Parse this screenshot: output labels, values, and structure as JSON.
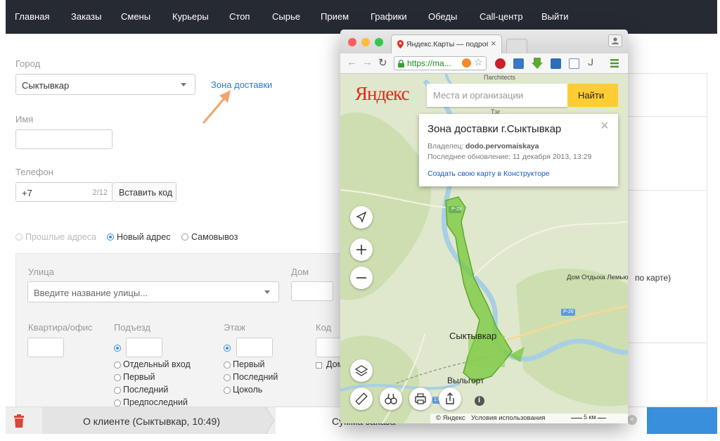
{
  "nav": {
    "items": [
      "Главная",
      "Заказы",
      "Смены",
      "Курьеры",
      "Стоп",
      "Сырье",
      "Прием",
      "Графики",
      "Обеды",
      "Call-центр",
      "Выйти"
    ]
  },
  "form": {
    "city_label": "Город",
    "city_value": "Сыктывкар",
    "zone_link": "Зона доставки",
    "name_label": "Имя",
    "phone_label": "Телефон",
    "phone_value": "+7",
    "phone_counter": "2/12",
    "insert_code_button": "Вставить код",
    "address_modes": {
      "past": "Прошлые адреса",
      "new": "Новый адрес",
      "pickup": "Самовывоз"
    },
    "street_label": "Улица",
    "street_placeholder": "Введите название улицы...",
    "house_label": "Дом",
    "apartment_label": "Квартира/офис",
    "entrance_label": "Подъезд",
    "floor_label": "Этаж",
    "code_label": "Код",
    "entrance_options": [
      "Отдельный вход",
      "Первый",
      "Последний",
      "Предпоследний"
    ],
    "floor_options": [
      "Первый",
      "Последний",
      "Цоколь"
    ],
    "intercom_partial": "Дом"
  },
  "right_panel": {
    "partial_text": "по карте)"
  },
  "bottom": {
    "client_tab": "О клиенте (Сыктывкар, 10:49)",
    "next_tab_partial": "Сумма заказа"
  },
  "browser": {
    "tab_title": "Яндекс.Карты — подробн",
    "url": "https://ma...",
    "colors": {
      "close_red": "#fc605c",
      "minimize_yellow": "#fdbc40",
      "maximize_green": "#34c84a"
    }
  },
  "map": {
    "logo": "Яндекс",
    "search_placeholder": "Места и организации",
    "search_button": "Найти",
    "popup": {
      "title": "Зона доставки г.Сыктывкар",
      "owner_label": "Владелец:",
      "owner": "dodo.pervomaiskaya",
      "updated": "Последнее обновление: 11 декабря 2013, 13:29",
      "create_link": "Создать свою карту в Конструкторе"
    },
    "labels": {
      "city": "Сыктывкар",
      "vylgort": "Выльгорт",
      "pargech": "Пarchitects",
      "teg": "Тэг",
      "lemyu": "Дом Отдыха Лемью",
      "r29": "Р-29",
      "r26": "Р-26",
      "r17": "17"
    },
    "copyright": "© Яндекс",
    "terms": "Условия использования",
    "scale": "5 км",
    "colors": {
      "zone": "#76c83b",
      "water": "#a8cfe4",
      "land": "#dfe8cc",
      "forest": "#cfe0b4",
      "search_button": "#ffcc33"
    }
  }
}
